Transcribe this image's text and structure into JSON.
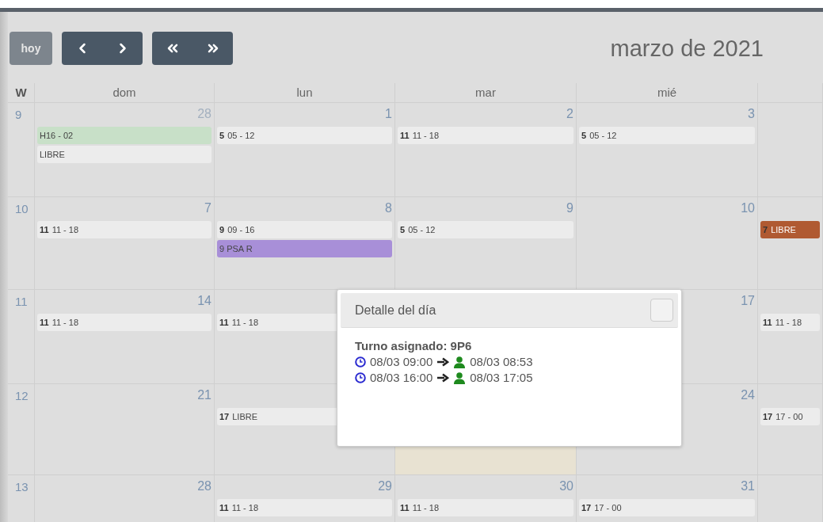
{
  "toolbar": {
    "today_button": "hoy",
    "title": "marzo de 2021"
  },
  "columns": [
    "W",
    "dom",
    "lun",
    "mar",
    "mié"
  ],
  "weeks": [
    {
      "week": "9",
      "dom": {
        "day": "28",
        "other_month": true,
        "events": [
          {
            "text": "H16 - 02",
            "color": "#c8e0c8"
          },
          {
            "text": "LIBRE",
            "color": "#ececec"
          }
        ]
      },
      "lun": {
        "day": "1",
        "events": [
          {
            "code": "5",
            "text": "05 - 12",
            "color": "#ececec"
          }
        ]
      },
      "mar": {
        "day": "2",
        "events": [
          {
            "code": "11",
            "text": "11 - 18",
            "color": "#ececec"
          }
        ]
      },
      "mie": {
        "day": "3",
        "events": [
          {
            "code": "5",
            "text": "05 - 12",
            "color": "#ececec"
          }
        ]
      }
    },
    {
      "week": "10",
      "dom": {
        "day": "7",
        "events": [
          {
            "code": "11",
            "text": "11 - 18",
            "color": "#ececec"
          }
        ]
      },
      "lun": {
        "day": "8",
        "events": [
          {
            "code": "9",
            "text": "09 - 16",
            "color": "#ececec"
          },
          {
            "text": "9 PSA R",
            "color": "#a88fd8"
          }
        ]
      },
      "mar": {
        "day": "9",
        "events": [
          {
            "code": "5",
            "text": "05 - 12",
            "color": "#ececec"
          }
        ]
      },
      "mie": {
        "day": "10"
      },
      "column_6": {
        "events": [
          {
            "code": "7",
            "text": "LIBRE",
            "color": "#b05a32"
          }
        ]
      }
    },
    {
      "week": "11",
      "dom": {
        "day": "14",
        "events": [
          {
            "code": "11",
            "text": "11 - 18",
            "color": "#ececec"
          }
        ]
      },
      "lun": {
        "events": [
          {
            "code": "11",
            "text": "11 - 18",
            "color": "#ececec"
          }
        ]
      },
      "mie": {
        "day": "17"
      },
      "column_6": {
        "events": [
          {
            "code": "11",
            "text": "11 - 18",
            "color": "#ececec"
          }
        ]
      }
    },
    {
      "week": "12",
      "dom": {
        "day": "21"
      },
      "lun": {
        "events": [
          {
            "code": "17",
            "text": "LIBRE",
            "color": "#ececec"
          }
        ]
      },
      "mar": {
        "today": true
      },
      "mie": {
        "day": "24"
      },
      "column_6": {
        "events": [
          {
            "code": "17",
            "text": "17 - 00",
            "color": "#ececec"
          }
        ]
      }
    },
    {
      "week": "13",
      "dom": {
        "day": "28"
      },
      "lun": {
        "day": "29",
        "events": [
          {
            "code": "11",
            "text": "11 - 18",
            "color": "#ececec"
          }
        ]
      },
      "mar": {
        "day": "30",
        "events": [
          {
            "code": "11",
            "text": "11 - 18",
            "color": "#ececec"
          }
        ]
      },
      "mie": {
        "day": "31",
        "events": [
          {
            "code": "17",
            "text": "17 - 00",
            "color": "#ececec"
          }
        ]
      }
    }
  ],
  "popup": {
    "title": "Detalle del día",
    "shift": "Turno asignado: 9P6",
    "entries": [
      {
        "scheduled": "08/03 09:00",
        "actual": "08/03 08:53"
      },
      {
        "scheduled": "08/03 16:00",
        "actual": "08/03 17:05"
      }
    ]
  }
}
